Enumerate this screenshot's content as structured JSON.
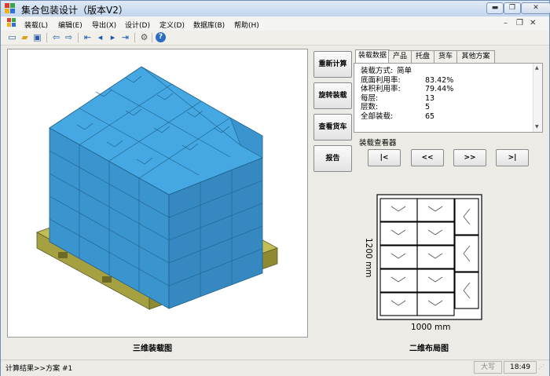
{
  "window": {
    "title": "集合包装设计（版本V2）",
    "controls": [
      "minimize-icon",
      "restore-icon",
      "close-icon"
    ]
  },
  "menu": {
    "items": [
      "装载(L)",
      "编辑(E)",
      "导出(X)",
      "设计(D)",
      "定义(D)",
      "数据库(B)",
      "帮助(H)"
    ],
    "mdi_controls": [
      "minimize-icon",
      "restore-icon",
      "close-icon"
    ]
  },
  "toolbar": {
    "icons": [
      "new-icon",
      "open-icon",
      "save-icon",
      "arrow-left-icon",
      "arrow-right-icon",
      "first-icon",
      "prev-icon",
      "next-icon",
      "last-icon",
      "settings-icon",
      "help-icon"
    ]
  },
  "actions": {
    "recalc": "重新计算",
    "rotate": "旋转装载",
    "view_truck": "查看货车",
    "report": "报告"
  },
  "tabs": [
    "装载数据",
    "产品",
    "托盘",
    "货车",
    "其他方案"
  ],
  "load_data": [
    {
      "key": "装载方式:",
      "value": "简单"
    },
    {
      "key": "底面利用率:",
      "value": "83.42%"
    },
    {
      "key": "体积利用率:",
      "value": "79.44%"
    },
    {
      "key": "每层:",
      "value": "13"
    },
    {
      "key": "层数:",
      "value": "5"
    },
    {
      "key": "全部装载:",
      "value": "65"
    }
  ],
  "viewer": {
    "label": "装载查看器",
    "buttons": [
      "|<",
      "<<",
      ">>",
      ">|"
    ]
  },
  "layout2d": {
    "width_label": "1000 mm",
    "length_label": "1200 mm",
    "caption": "二维布局图"
  },
  "view3d_caption": "三维装载图",
  "status": {
    "text": "计算结果>>方案 #1",
    "caps": "大写",
    "time": "18:49"
  },
  "colors": {
    "box": "#3d9ed8",
    "pallet": "#b7b24a",
    "title_bar": "#c9daef"
  }
}
